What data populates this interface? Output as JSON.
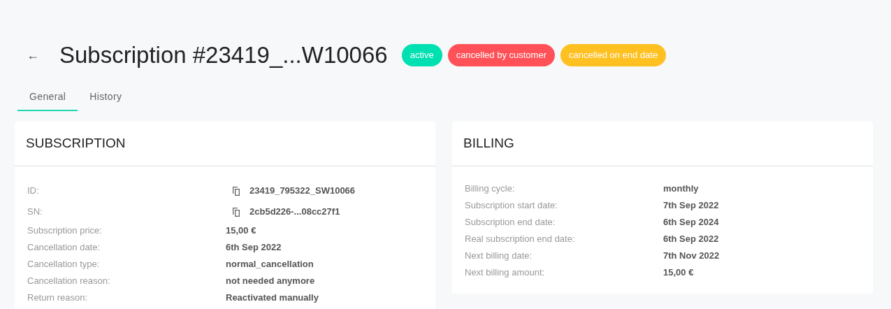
{
  "header": {
    "back": "←",
    "title": "Subscription #23419_...W10066",
    "badges": [
      {
        "label": "active",
        "color": "#00e0b0"
      },
      {
        "label": "cancelled by customer",
        "color": "#ff5157"
      },
      {
        "label": "cancelled on end date",
        "color": "#ffc021"
      }
    ]
  },
  "tabs": [
    {
      "label": "General",
      "selected": true
    },
    {
      "label": "History",
      "selected": false
    }
  ],
  "cards": [
    {
      "title": "SUBSCRIPTION",
      "rows": [
        {
          "kind": "copyable",
          "label": "ID:",
          "value": "23419_795322_SW10066"
        },
        {
          "kind": "copyable",
          "label": "SN:",
          "value": "2cb5d226-...08cc27f1"
        },
        {
          "kind": "plain",
          "label": "Subscription price:",
          "value": "15,00 €"
        },
        {
          "kind": "plain",
          "label": "Cancellation date:",
          "value": "6th Sep 2022"
        },
        {
          "kind": "plain",
          "label": "Cancellation type:",
          "value": "normal_cancellation"
        },
        {
          "kind": "plain",
          "label": "Cancellation reason:",
          "value": "not needed anymore"
        },
        {
          "kind": "plain",
          "label": "Return reason:",
          "value": "Reactivated manually"
        }
      ]
    },
    {
      "title": "BILLING",
      "rows": [
        {
          "kind": "plain",
          "label": "Billing cycle:",
          "value": "monthly"
        },
        {
          "kind": "plain",
          "label": "Subscription start date:",
          "value": "7th Sep 2022"
        },
        {
          "kind": "plain",
          "label": "Subscription end date:",
          "value": "6th Sep 2024"
        },
        {
          "kind": "plain",
          "label": "Real subscription end date:",
          "value": "6th Sep 2022"
        },
        {
          "kind": "plain",
          "label": "Next billing date:",
          "value": "7th Nov 2022"
        },
        {
          "kind": "plain",
          "label": "Next billing amount:",
          "value": "15,00 €"
        }
      ]
    }
  ]
}
